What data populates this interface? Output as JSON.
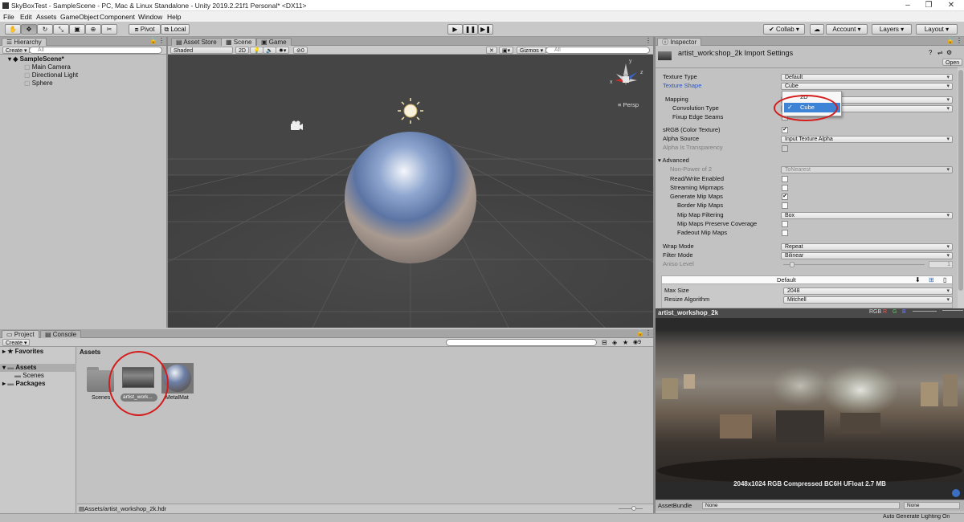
{
  "window": {
    "title": "SkyBoxTest - SampleScene - PC, Mac & Linux Standalone - Unity 2019.2.21f1 Personal* <DX11>",
    "controls": [
      "–",
      "❐",
      "✕"
    ]
  },
  "menu": [
    "File",
    "Edit",
    "Assets",
    "GameObject",
    "Component",
    "Window",
    "Help"
  ],
  "toolbar": {
    "pivot": "Pivot",
    "local": "Local",
    "collab": "Collab ▾",
    "account": "Account ▾",
    "layers": "Layers ▾",
    "layout": "Layout ▾"
  },
  "hierarchy": {
    "tab": "Hierarchy",
    "create": "Create ▾",
    "search_placeholder": "All",
    "scene": "SampleScene*",
    "items": [
      "Main Camera",
      "Directional Light",
      "Sphere"
    ]
  },
  "center_tabs": [
    "Asset Store",
    "Scene",
    "Game"
  ],
  "scene_view": {
    "shading": "Shaded",
    "mode_2d": "2D",
    "fx_count": "0",
    "gizmos": "Gizmos ▾",
    "search_placeholder": "All",
    "persp": "Persp",
    "axes": {
      "y": "y",
      "x": "x",
      "z": "z"
    }
  },
  "inspector": {
    "tab": "Inspector",
    "title": "artist_work:shop_2k Import Settings",
    "open": "Open",
    "rows": [
      {
        "label": "Texture Type",
        "value": "Default"
      },
      {
        "label": "Texture Shape",
        "value": "Cube"
      },
      {
        "label": "Mapping",
        "value": ""
      },
      {
        "label": "Convolution Type",
        "value": ""
      },
      {
        "label": "Fixup Edge Seams",
        "value": ""
      },
      {
        "label": "sRGB (Color Texture)",
        "value": ""
      },
      {
        "label": "Alpha Source",
        "value": "Input Texture Alpha"
      },
      {
        "label": "Alpha Is Transparency",
        "value": ""
      },
      {
        "label": "Advanced",
        "value": ""
      },
      {
        "label": "Non-Power of 2",
        "value": "ToNearest"
      },
      {
        "label": "Read/Write Enabled",
        "value": ""
      },
      {
        "label": "Streaming Mipmaps",
        "value": ""
      },
      {
        "label": "Generate Mip Maps",
        "value": ""
      },
      {
        "label": "Border Mip Maps",
        "value": ""
      },
      {
        "label": "Mip Map Filtering",
        "value": "Box"
      },
      {
        "label": "Mip Maps Preserve Coverage",
        "value": ""
      },
      {
        "label": "Fadeout Mip Maps",
        "value": ""
      },
      {
        "label": "Wrap Mode",
        "value": "Repeat"
      },
      {
        "label": "Filter Mode",
        "value": "Bilinear"
      },
      {
        "label": "Aniso Level",
        "value": "1"
      }
    ],
    "platform_default": "Default",
    "max_size_label": "Max Size",
    "max_size": "2048",
    "resize_label": "Resize Algorithm",
    "resize": "Mitchell",
    "shape_popup": {
      "option_2d": "2D",
      "option_cube": "Cube"
    }
  },
  "preview": {
    "name": "artist_workshop_2k",
    "channels": [
      "RGB",
      "R",
      "G",
      "B"
    ],
    "info": "2048x1024  RGB Compressed BC6H UFloat  2.7 MB",
    "assetbundle_label": "AssetBundle",
    "assetbundle_value": "None",
    "variant_value": "None",
    "status": "Auto Generate Lighting On"
  },
  "project": {
    "tabs": [
      "Project",
      "Console"
    ],
    "create": "Create ▾",
    "search_placeholder": "",
    "badge_count": "9",
    "tree": [
      "Favorites",
      "Assets",
      "Scenes",
      "Packages"
    ],
    "breadcrumb": "Assets",
    "assets": [
      "Scenes",
      "artist_work...",
      "MetalMat"
    ],
    "selected_path": "Assets/artist_workshop_2k.hdr"
  }
}
